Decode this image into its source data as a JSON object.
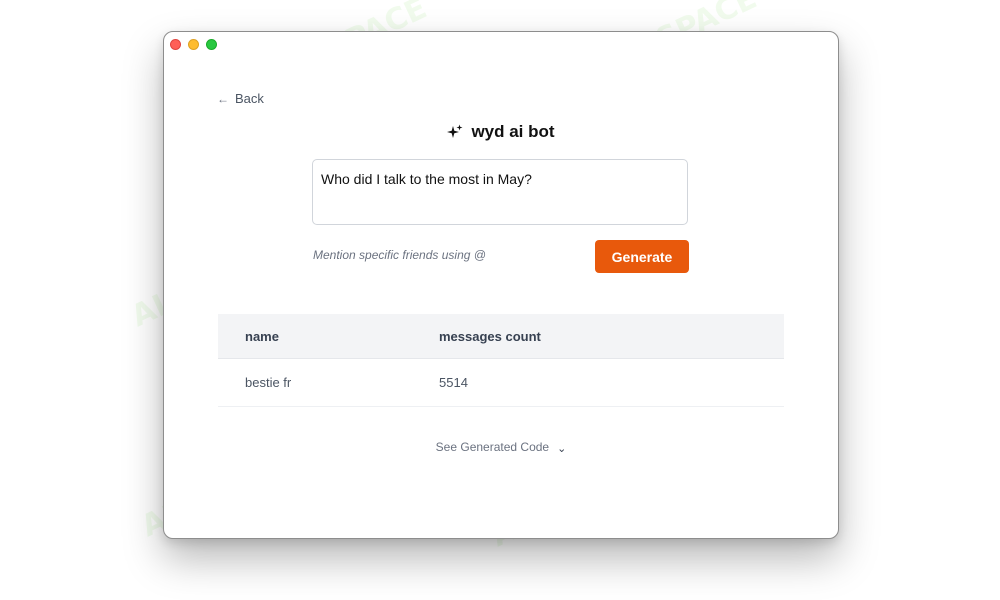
{
  "window": {
    "traffic_lights": [
      "close",
      "minimize",
      "zoom"
    ]
  },
  "nav": {
    "back_label": "Back"
  },
  "app": {
    "title": "wyd ai bot",
    "title_icon": "sparkles-icon"
  },
  "prompt": {
    "value": "Who did I talk to the most in May?"
  },
  "hint": "Mention specific friends using @",
  "generate_label": "Generate",
  "results": {
    "columns": [
      "name",
      "messages count"
    ],
    "rows": [
      [
        "bestie fr",
        "5514"
      ]
    ]
  },
  "see_code_label": "See Generated Code",
  "watermark": "AI TALENT SPACE",
  "colors": {
    "accent": "#e8590c",
    "header_bg": "#f3f4f6"
  }
}
